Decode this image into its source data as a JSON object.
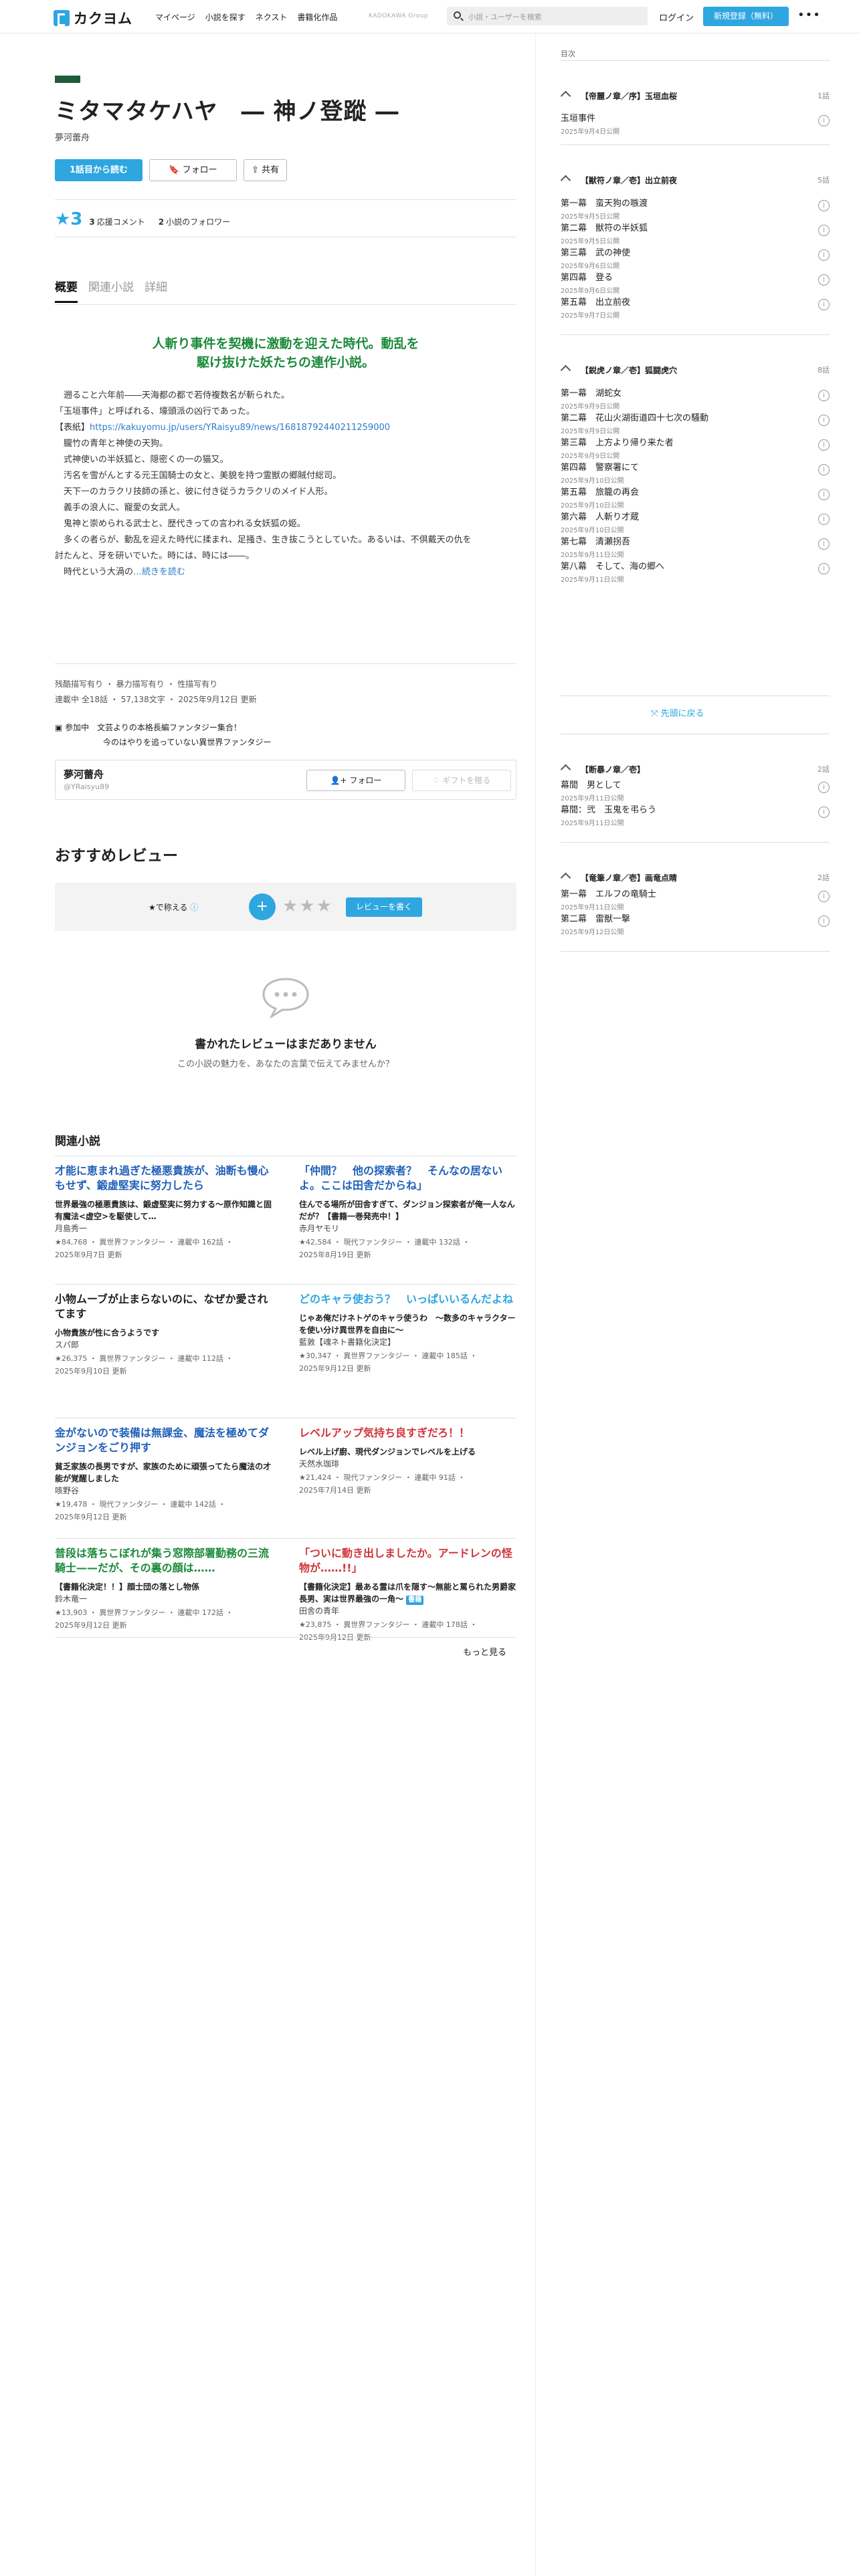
{
  "header": {
    "logo": "カクヨム",
    "nav": [
      "マイページ",
      "小説を探す",
      "ネクスト",
      "書籍化作品"
    ],
    "group": "KADOKAWA Group",
    "search_placeholder": "小説・ユーザーを検索",
    "login": "ログイン",
    "signup": "新規登録（無料）",
    "more": "•••"
  },
  "work": {
    "title": "ミタマタケハヤ　― 神ノ登蹤 ―",
    "author": "夢河蕾舟",
    "read_first": "1話目から読む",
    "follow": "フォロー",
    "share": "共有",
    "stars": "★3",
    "cheer_count": "3",
    "cheer_label": "応援コメント",
    "follow_count": "2",
    "follow_label": "小説のフォロワー"
  },
  "tabs": [
    "概要",
    "関連小説",
    "詳細"
  ],
  "catch_line1": "人斬り事件を契機に激動を迎えた時代。動乱を",
  "catch_line2": "駆け抜けた妖たちの連作小説。",
  "intro": [
    "　遡ること六年前――天海都の都で若侍複数名が斬られた。",
    "「玉垣事件」と呼ばれる、壕頭派の凶行であった。",
    "【表紙】",
    "",
    "　朧竹の青年と神使の天狗。",
    "　式神使いの半妖狐と、隠密くの一の猫又。",
    "　汚名を雪がんとする元王国騎士の女と、美貌を持つ霊獣の郷賊付総司。",
    "　天下一のカラクリ技師の孫と、彼に付き従うカラクリのメイド人形。",
    "　義手の浪人に、寵愛の女武人。",
    "　鬼神と崇められる武士と、歴代きっての言われる女妖狐の姫。",
    "",
    "",
    "　多くの者らが、動乱を迎えた時代に揉まれ、足掻き、生き抜こうとしていた。あるいは、不倶戴天の仇を",
    "討たんと、牙を研いでいた。時には、時には――。",
    "　時代という大渦の"
  ],
  "intro_link_url": "https://kakuyomu.jp/users/YRaisyu89/news/16818792440211259000",
  "intro_more": "…続きを読む",
  "meta1": "残酷描写有り ・ 暴力描写有り ・ 性描写有り",
  "meta2": "連載中 全18話 ・ 57,138文字 ・ 2025年9月12日 更新",
  "event_line1": "参加中　文芸よりの本格長編ファンタジー集合！",
  "event_line2": "今のはやりを追っていない異世界ファンタジー",
  "author_box": {
    "name": "夢河蕾舟",
    "id": "@YRaisyu89",
    "follow": "フォロー",
    "gift": "ギフトを贈る"
  },
  "reviews": {
    "heading": "おすすめレビュー",
    "label": "★で称える",
    "plus": "+",
    "stars": "★★★",
    "write": "レビューを書く",
    "empty": "書かれたレビューはまだありません",
    "empty_sub": "この小説の魅力を、あなたの言葉で伝えてみませんか？"
  },
  "related": {
    "heading": "関連小説",
    "more": "もっと見る",
    "items": [
      {
        "title": "才能に恵まれ過ぎた極悪貴族が、油断も慢心もせず、鍛虚堅実に努力したら",
        "color": "#1f5fb8",
        "desc": "世界最強の極悪貴族は、鍛虚堅実に努力する〜原作知識と固有魔法<虚空>を駆使して…",
        "author": "月島秀一",
        "stats": "★84,768 ・ 異世界ファンタジー ・ 連載中 162話 ・",
        "date": "2025年9月7日 更新"
      },
      {
        "title": "「仲間？　他の探索者？　そんなの居ないよ。ここは田舎だからね」",
        "color": "#1f5fb8",
        "desc": "住んでる場所が田舎すぎて、ダンジョン探索者が俺一人なんだが？【書籍一巻発売中！】",
        "author": "赤月ヤモリ",
        "stats": "★42,584 ・ 現代ファンタジー ・ 連載中 132話 ・",
        "date": "2025年8月19日 更新"
      },
      {
        "title": "小物ムーブが止まらないのに、なぜか愛されてます",
        "color": "#222222",
        "desc": "小物貴族が性に合うようです",
        "author": "スパ郎",
        "stats": "★26,375 ・ 異世界ファンタジー ・ 連載中 112話 ・",
        "date": "2025年9月10日 更新"
      },
      {
        "title": "どのキャラ使おう？　いっぱいいるんだよね",
        "color": "#2ea6e0",
        "desc": "じゃあ俺だけネトゲのキャラ使うわ　〜数多のキャラクターを使い分け異世界を自由に〜",
        "author": "藍敦【魂ネト書籍化決定】",
        "stats": "★30,347 ・ 異世界ファンタジー ・ 連載中 185話 ・",
        "date": "2025年9月12日 更新"
      },
      {
        "title": "金がないので装備は無課金、魔法を極めてダンジョンをごり押す",
        "color": "#1f5fb8",
        "desc": "貧乏家族の長男ですが、家族のために頑張ってたら魔法の才能が覚醒しました",
        "author": "咳野谷",
        "stats": "★19,478 ・ 現代ファンタジー ・ 連載中 142話 ・",
        "date": "2025年9月12日 更新"
      },
      {
        "title": "レベルアップ気持ち良すぎだろ！！",
        "color": "#d0343a",
        "desc": "レベル上げ廚、現代ダンジョンでレベルを上げる",
        "author": "天然水珈琲",
        "stats": "★21,424 ・ 現代ファンタジー ・ 連載中 91話 ・",
        "date": "2025年7月14日 更新"
      },
      {
        "title": "普段は落ちこぼれが集う窓際部署勤務の三流騎士——だが、その裏の顔は……",
        "color": "#1a8a3a",
        "desc": "【書籍化決定！！】顔士団の落とし物係",
        "author": "鈴木竜一",
        "stats": "★13,903 ・ 異世界ファンタジー ・ 連載中 172話 ・",
        "date": "2025年9月12日 更新"
      },
      {
        "title": "「ついに動き出しましたか。アードレンの怪物が……!!」",
        "color": "#d0343a",
        "desc": "【書籍化決定】最ある霊は爪を隠す〜無能と罵られた男爵家長男、実は世界最強の一角〜",
        "tag": "書籍",
        "author": "田舎の青年",
        "stats": "★23,875 ・ 異世界ファンタジー ・ 連載中 178話 ・",
        "date": "2025年9月12日 更新"
      }
    ]
  },
  "toc": {
    "label": "目次",
    "to_top": "先頭に戻る",
    "chapters": [
      {
        "name": "【帝麗ノ章／序】玉垣血桜",
        "count": "1話",
        "eps": [
          {
            "t": "玉垣事件",
            "d": "2025年9月4日公開"
          }
        ]
      },
      {
        "name": "【獣符ノ章／壱】出立前夜",
        "count": "5話",
        "eps": [
          {
            "t": "第一幕　蛮天狗の嗾渡",
            "d": "2025年9月5日公開"
          },
          {
            "t": "第二幕　獣符の半妖狐",
            "d": "2025年9月5日公開"
          },
          {
            "t": "第三幕　武の神使",
            "d": "2025年9月6日公開"
          },
          {
            "t": "第四幕　登る",
            "d": "2025年9月6日公開"
          },
          {
            "t": "第五幕　出立前夜",
            "d": "2025年9月7日公開"
          }
        ]
      },
      {
        "name": "【鋭虎ノ章／壱】狐闘虎穴",
        "count": "8話",
        "eps": [
          {
            "t": "第一幕　湖蛇女",
            "d": "2025年9月9日公開"
          },
          {
            "t": "第二幕　花山火湖街道四十七次の騒動",
            "d": "2025年9月9日公開"
          },
          {
            "t": "第三幕　上方より帰り来た者",
            "d": "2025年9月9日公開"
          },
          {
            "t": "第四幕　警察署にて",
            "d": "2025年9月10日公開"
          },
          {
            "t": "第五幕　旅籠の再会",
            "d": "2025年9月10日公開"
          },
          {
            "t": "第六幕　人斬り才蔵",
            "d": "2025年9月10日公開"
          },
          {
            "t": "第七幕　清瀬拐吾",
            "d": "2025年9月11日公開"
          },
          {
            "t": "第八幕　そして、海の郷へ",
            "d": "2025年9月11日公開"
          }
        ]
      },
      {
        "name": "【断暴ノ章／壱】",
        "count": "2話",
        "eps": [
          {
            "t": "幕間　男として",
            "d": "2025年9月11日公開"
          },
          {
            "t": "幕間：弐　玉鬼を弔らう",
            "d": "2025年9月11日公開"
          }
        ]
      },
      {
        "name": "【竜筆ノ章／壱】画竜点睛",
        "count": "2話",
        "eps": [
          {
            "t": "第一幕　エルフの竜騎士",
            "d": "2025年9月11日公開"
          },
          {
            "t": "第二幕　雷獣一撃",
            "d": "2025年9月12日公開"
          }
        ]
      }
    ]
  }
}
